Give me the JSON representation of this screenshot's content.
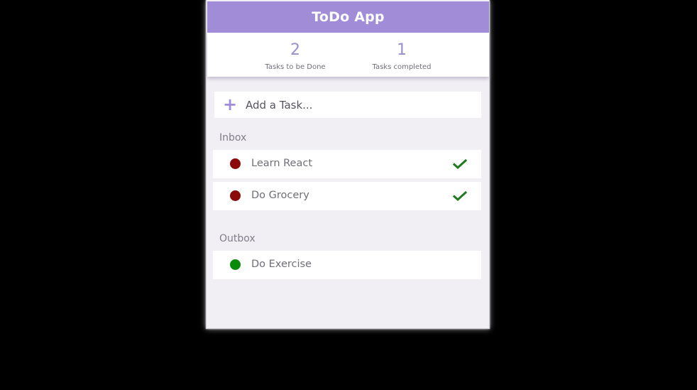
{
  "header": {
    "title": "ToDo App",
    "color": "#a18cd8"
  },
  "stats": {
    "todo": {
      "count": "2",
      "label": "Tasks to be Done"
    },
    "done": {
      "count": "1",
      "label": "Tasks completed"
    }
  },
  "add_task": {
    "icon": "plus-icon",
    "label": "Add a Task..."
  },
  "inbox": {
    "title": "Inbox",
    "items": [
      {
        "label": "Learn React",
        "status_color": "#8b0a0a",
        "action_icon": "check-icon"
      },
      {
        "label": "Do Grocery",
        "status_color": "#8b0a0a",
        "action_icon": "check-icon"
      }
    ]
  },
  "outbox": {
    "title": "Outbox",
    "items": [
      {
        "label": "Do Exercise",
        "status_color": "#0a8a0a"
      }
    ]
  },
  "colors": {
    "check": "#1f7a1f",
    "pending": "#8b0a0a",
    "completed": "#0a8a0a"
  }
}
